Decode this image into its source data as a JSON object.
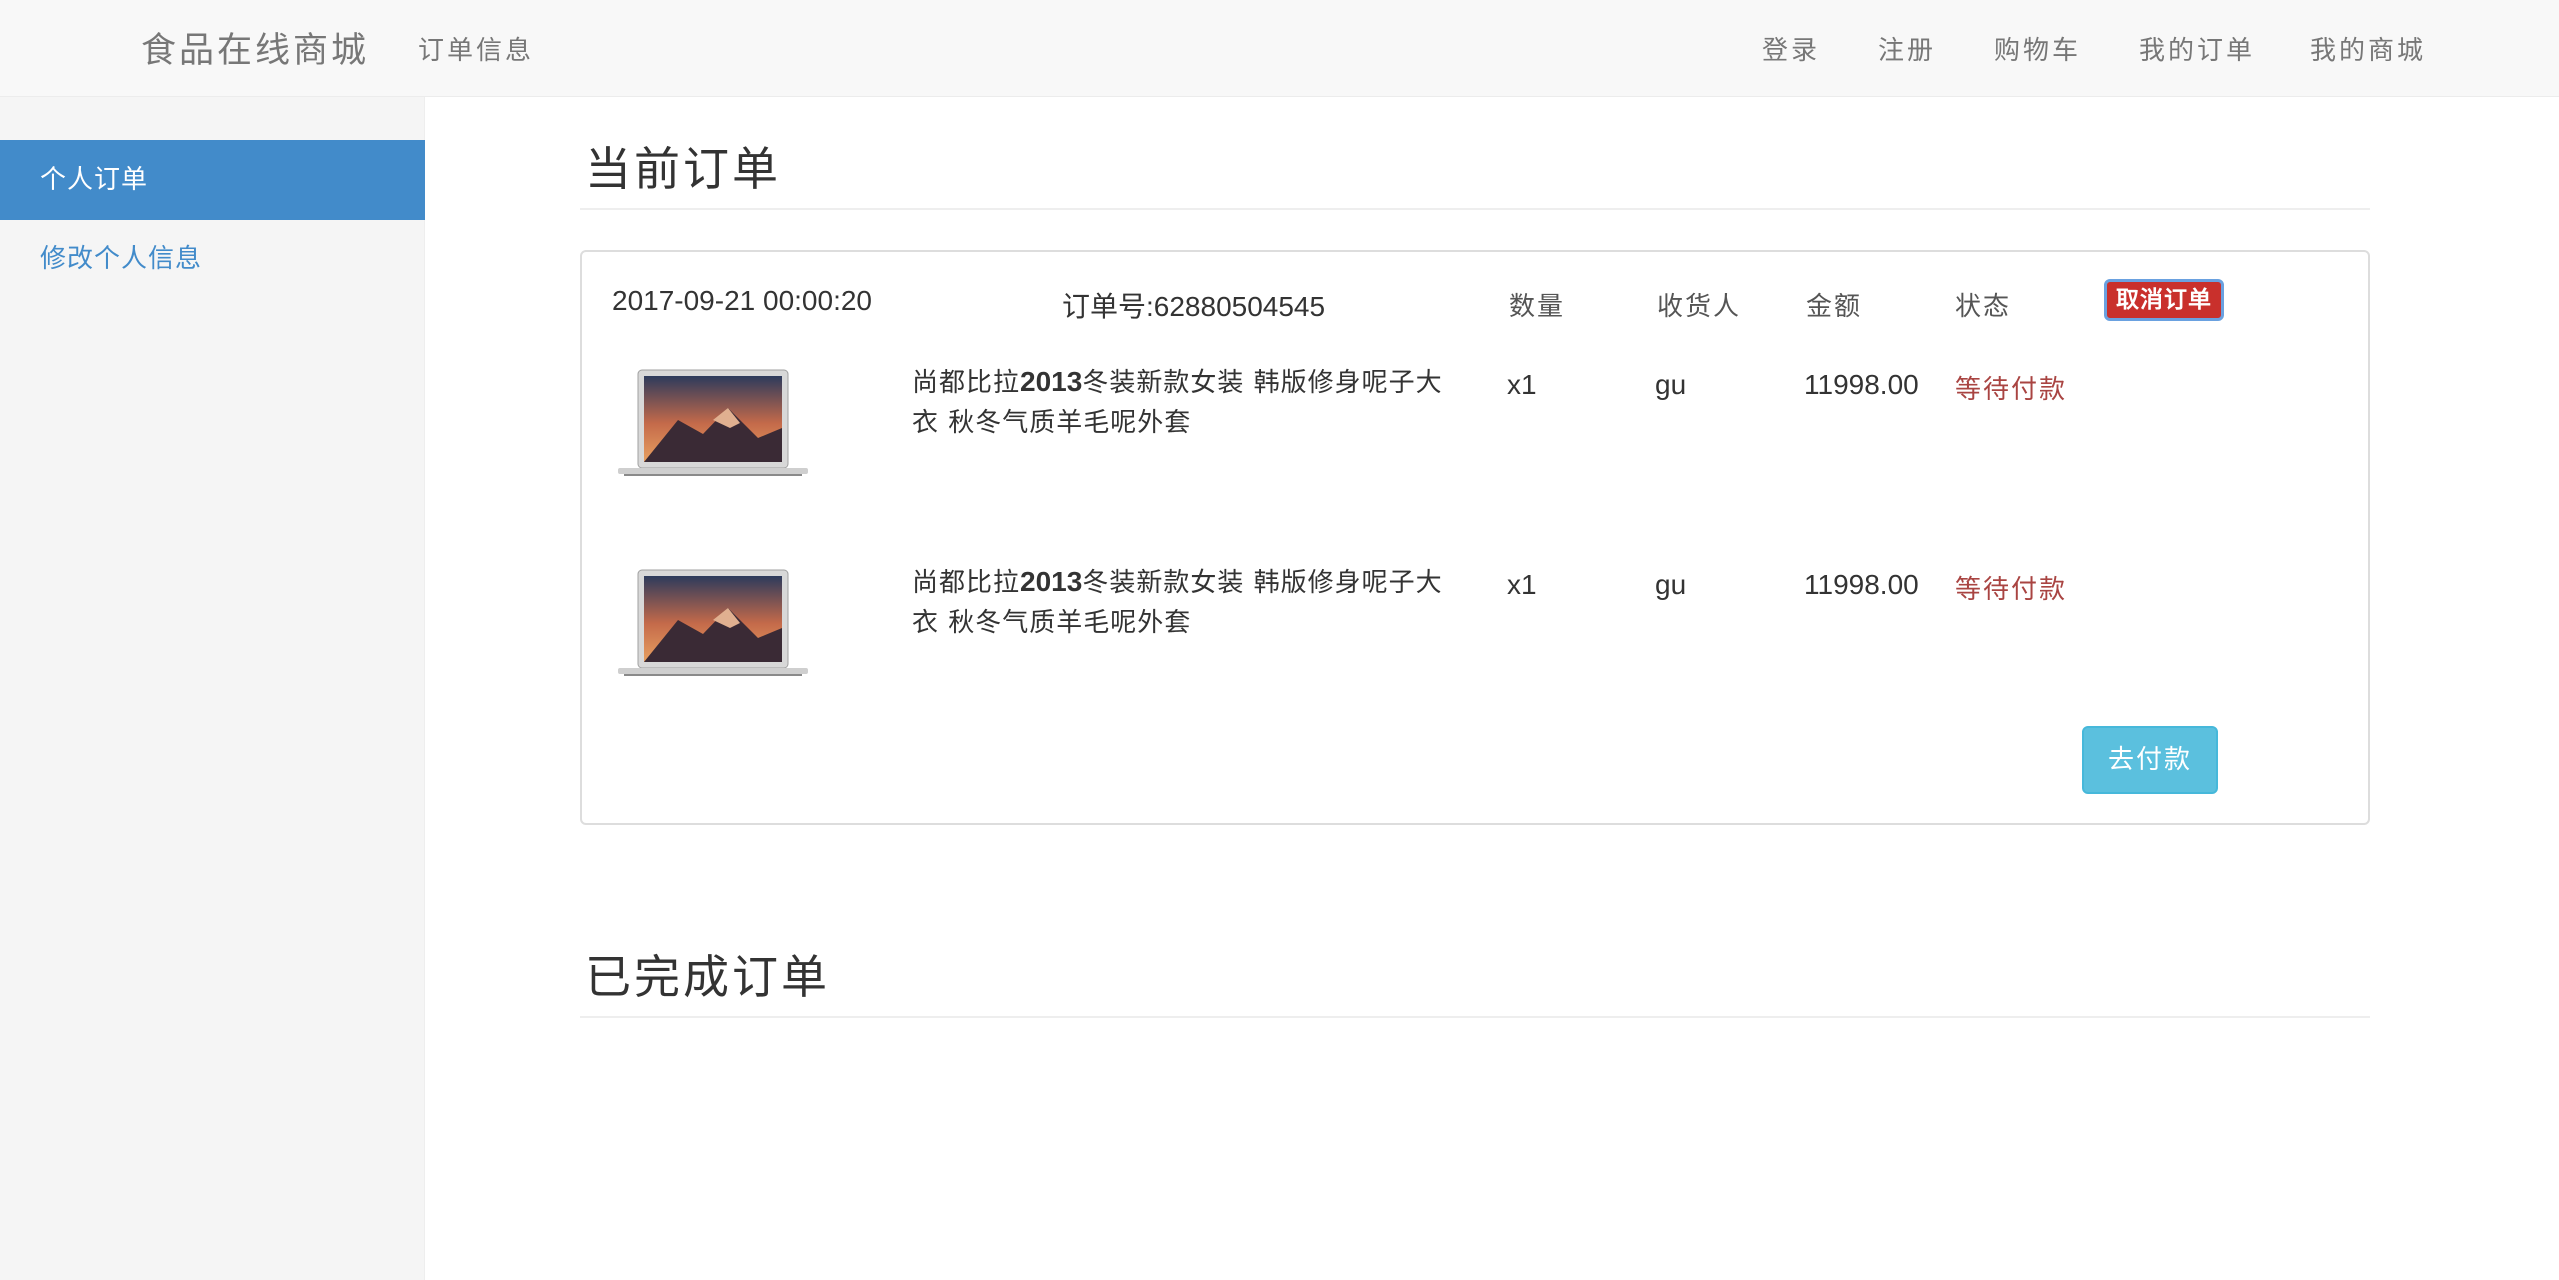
{
  "navbar": {
    "brand": "食品在线商城",
    "left_link": "订单信息",
    "right_links": [
      "登录",
      "注册",
      "购物车",
      "我的订单",
      "我的商城"
    ]
  },
  "sidebar": {
    "items": [
      {
        "label": "个人订单",
        "active": true
      },
      {
        "label": "修改个人信息",
        "active": false
      }
    ]
  },
  "current_orders": {
    "title": "当前订单",
    "order": {
      "datetime": "2017-09-21 00:00:20",
      "order_number": "订单号:62880504545",
      "headers": {
        "qty": "数量",
        "receiver": "收货人",
        "amount": "金额",
        "status": "状态"
      },
      "cancel_label": "取消订单",
      "items": [
        {
          "name_prefix": "尚都比拉",
          "name_bold": "2013",
          "name_suffix": "冬装新款女装 韩版修身呢子大衣 秋冬气质羊毛呢外套",
          "qty": "x1",
          "receiver": "gu",
          "amount": "11998.00",
          "status": "等待付款",
          "thumbnail": "laptop-image"
        },
        {
          "name_prefix": "尚都比拉",
          "name_bold": "2013",
          "name_suffix": "冬装新款女装 韩版修身呢子大衣 秋冬气质羊毛呢外套",
          "qty": "x1",
          "receiver": "gu",
          "amount": "11998.00",
          "status": "等待付款",
          "thumbnail": "laptop-image"
        }
      ],
      "pay_label": "去付款"
    }
  },
  "completed_orders": {
    "title": "已完成订单"
  },
  "colors": {
    "primary": "#428bca",
    "danger": "#c9302c",
    "info": "#5bc0de",
    "status_text": "#a94442"
  }
}
